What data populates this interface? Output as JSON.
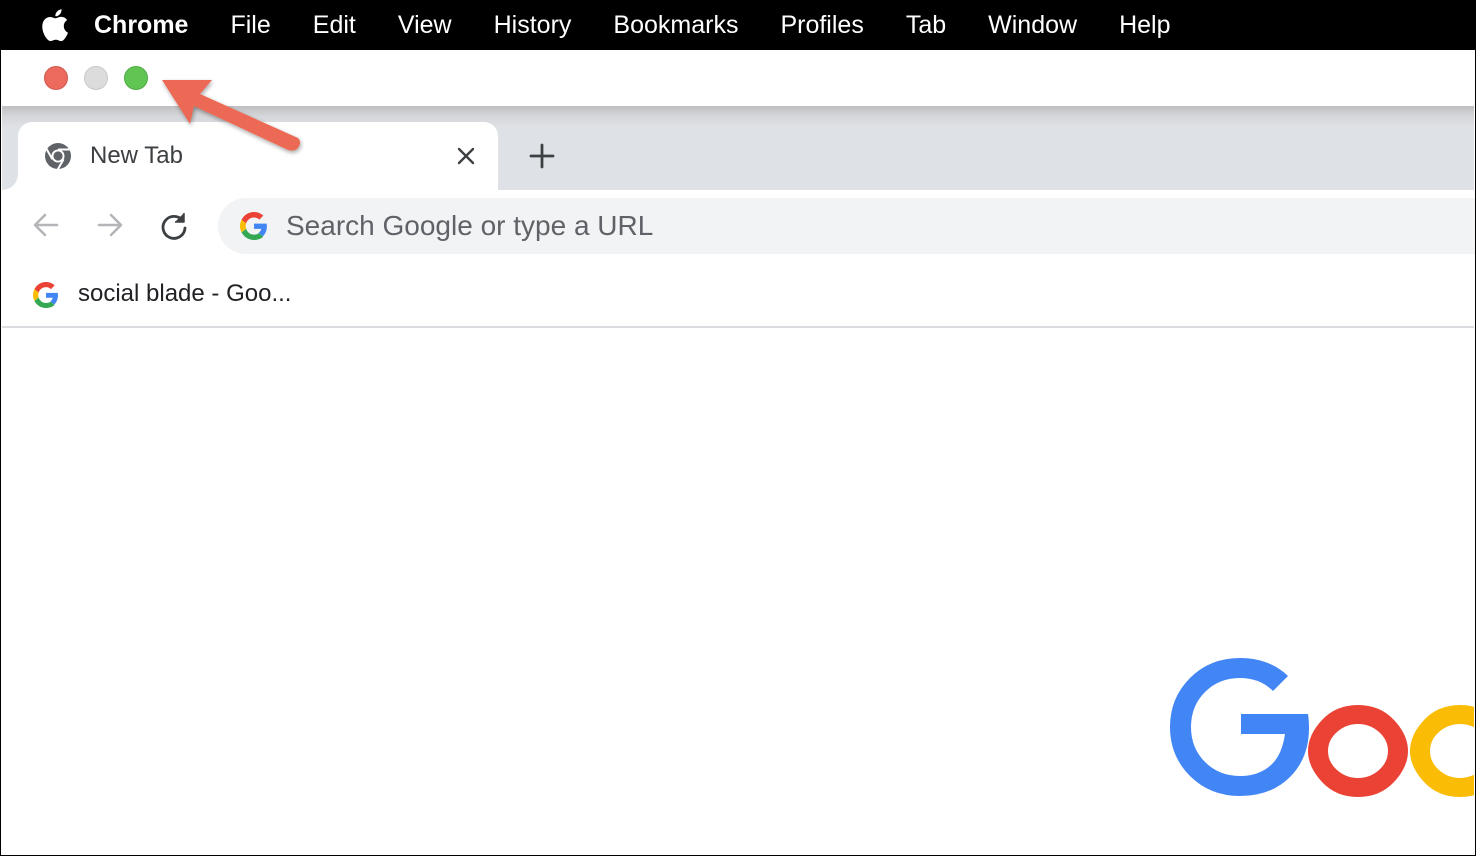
{
  "menubar": {
    "apple_icon": "apple-logo-icon",
    "app_name": "Chrome",
    "items": [
      "File",
      "Edit",
      "View",
      "History",
      "Bookmarks",
      "Profiles",
      "Tab",
      "Window",
      "Help"
    ]
  },
  "window_controls": {
    "close_color": "#ec6a5e",
    "minimize_color": "#dcdcdc",
    "fullscreen_color": "#61c554"
  },
  "tab": {
    "title": "New Tab",
    "icon": "chrome-logo-icon",
    "close_icon": "close-icon"
  },
  "new_tab_icon": "plus-icon",
  "toolbar": {
    "back_icon": "arrow-left-icon",
    "forward_icon": "arrow-right-icon",
    "reload_icon": "reload-icon"
  },
  "omnibox": {
    "icon": "google-g-icon",
    "placeholder": "Search Google or type a URL"
  },
  "bookmarks": [
    {
      "label": "social blade - Goo...",
      "icon": "google-g-icon"
    }
  ],
  "annotation": {
    "arrow_color": "#ec6a55"
  },
  "google_logo": {
    "text": "Goo",
    "colors": [
      "#4285f4",
      "#ea4335",
      "#fbbc05"
    ]
  }
}
